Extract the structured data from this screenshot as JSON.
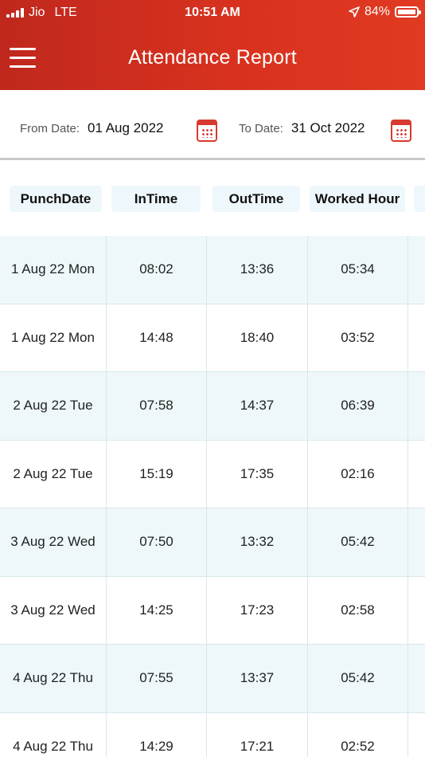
{
  "status_bar": {
    "carrier": "Jio",
    "network": "LTE",
    "time": "10:51 AM",
    "battery": "84%",
    "battery_level": 0.84
  },
  "header": {
    "title": "Attendance Report",
    "background_color": "#d32f21"
  },
  "filter": {
    "from_label": "From Date:",
    "from_value": "01 Aug 2022",
    "to_label": "To Date:",
    "to_value": "31 Oct 2022",
    "icon": "calendar-icon"
  },
  "table": {
    "columns": [
      "PunchDate",
      "InTime",
      "OutTime",
      "Worked Hour"
    ],
    "rows": [
      {
        "date": "1 Aug 22 Mon",
        "in": "08:02",
        "out": "13:36",
        "worked": "05:34"
      },
      {
        "date": "1 Aug 22 Mon",
        "in": "14:48",
        "out": "18:40",
        "worked": "03:52"
      },
      {
        "date": "2 Aug 22 Tue",
        "in": "07:58",
        "out": "14:37",
        "worked": "06:39"
      },
      {
        "date": "2 Aug 22 Tue",
        "in": "15:19",
        "out": "17:35",
        "worked": "02:16"
      },
      {
        "date": "3 Aug 22 Wed",
        "in": "07:50",
        "out": "13:32",
        "worked": "05:42"
      },
      {
        "date": "3 Aug 22 Wed",
        "in": "14:25",
        "out": "17:23",
        "worked": "02:58"
      },
      {
        "date": "4 Aug 22 Thu",
        "in": "07:55",
        "out": "13:37",
        "worked": "05:42"
      },
      {
        "date": "4 Aug 22 Thu",
        "in": "14:29",
        "out": "17:21",
        "worked": "02:52"
      }
    ]
  }
}
